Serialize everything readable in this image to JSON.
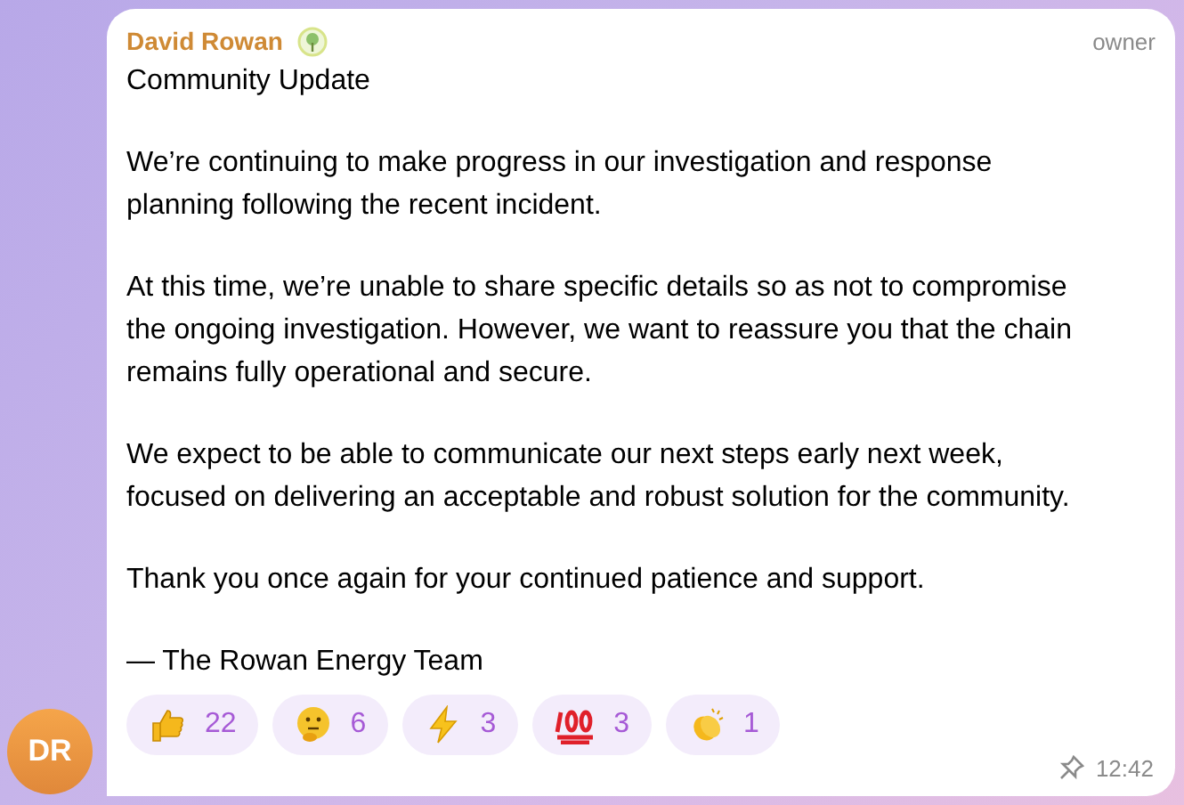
{
  "message": {
    "author": "David Rowan",
    "role": "owner",
    "title": "Community Update",
    "paragraphs": [
      "We’re continuing to make progress in our investigation and response planning following the recent incident.",
      "At this time, we’re unable to share specific details so as not to compromise the ongoing investigation. However, we want to reassure you that the chain remains fully operational and secure.",
      "We expect to be able to communicate our next steps early next week, focused on delivering an acceptable and robust solution for the community.",
      "Thank you once again for your continued patience and support.",
      "— The Rowan Energy Team"
    ],
    "reactions": [
      {
        "kind": "thumbs",
        "count": "22"
      },
      {
        "kind": "thinking",
        "count": "6"
      },
      {
        "kind": "zap",
        "count": "3"
      },
      {
        "kind": "hundred",
        "count": "3"
      },
      {
        "kind": "clap",
        "count": "1"
      }
    ],
    "pinned": true,
    "time": "12:42",
    "avatar": "DR"
  }
}
